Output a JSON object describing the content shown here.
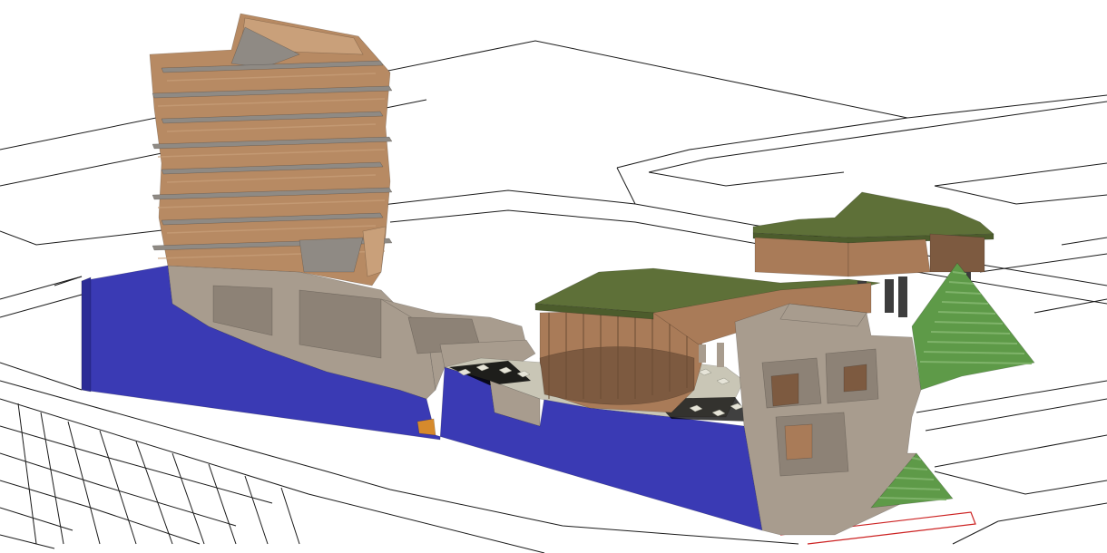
{
  "scene": {
    "kind": "3d-architectural-model-viewport",
    "background": "#ffffff",
    "colors": {
      "linework": "#1a1a1a",
      "site_boundary": "#cc2222",
      "terrain_section": "#3a3ab4",
      "terrain_section_dark": "#2c2c96",
      "masonry": "#a89c8e",
      "masonry_dark": "#8d8276",
      "tower_wood": "#b78a63",
      "tower_wood_light": "#c9a07a",
      "slab_grey": "#8f8a84",
      "roof_green": "#5e7038",
      "roof_green_dark": "#4c5c2c",
      "glass_brown": "#a97b58",
      "stair_green": "#5e9a48",
      "stair_green_light": "#7fb36a",
      "column_dark": "#3d3d3d",
      "orange_accent": "#d68a2c",
      "paving": "#c9c6b6"
    },
    "objects": [
      "terrain-section",
      "tower",
      "stone-base",
      "courtyard",
      "pavilion-lower",
      "pavilion-upper",
      "stone-block",
      "terraced-stair-upper",
      "terraced-stair-lower",
      "site-boundary"
    ],
    "tower_floor_bands": 8
  }
}
